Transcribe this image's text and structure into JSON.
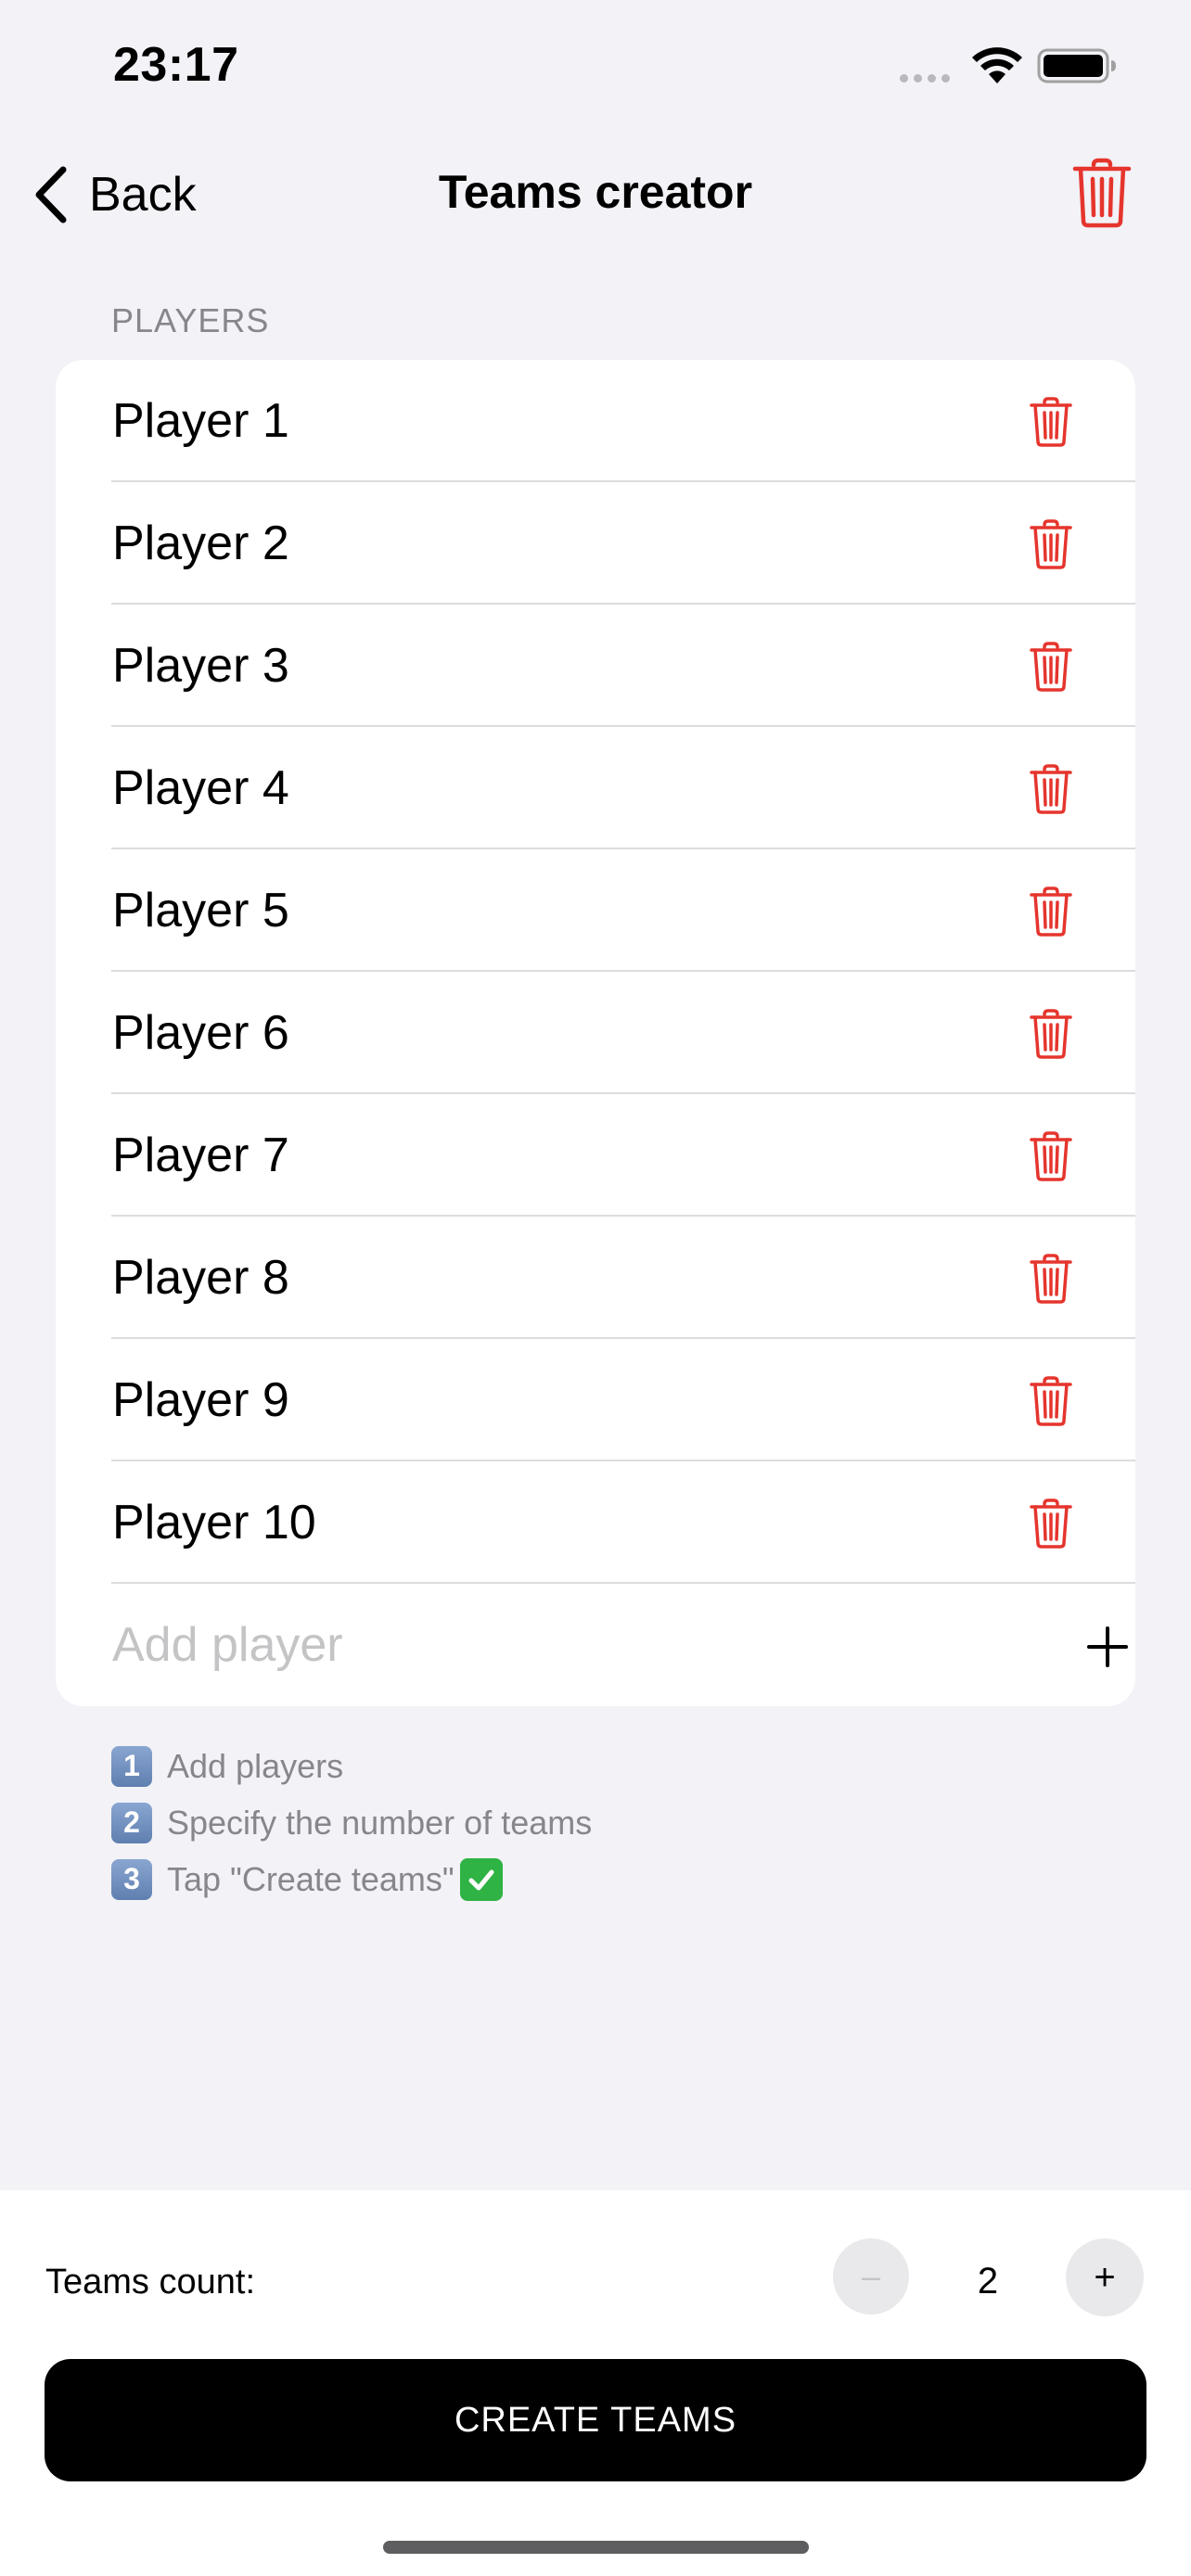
{
  "status_bar": {
    "time": "23:17",
    "icons": [
      "signal-dots-icon",
      "wifi-icon",
      "battery-icon"
    ]
  },
  "nav": {
    "back_label": "Back",
    "title": "Teams creator",
    "trash_icon": "trash-icon"
  },
  "section_header": "PLAYERS",
  "players": [
    {
      "name": "Player 1"
    },
    {
      "name": "Player 2"
    },
    {
      "name": "Player 3"
    },
    {
      "name": "Player 4"
    },
    {
      "name": "Player 5"
    },
    {
      "name": "Player 6"
    },
    {
      "name": "Player 7"
    },
    {
      "name": "Player 8"
    },
    {
      "name": "Player 9"
    },
    {
      "name": "Player 10"
    }
  ],
  "add_player": {
    "placeholder": "Add player",
    "value": ""
  },
  "instructions": [
    {
      "number": "1",
      "text": "Add players"
    },
    {
      "number": "2",
      "text": "Specify the number of teams"
    },
    {
      "number": "3",
      "text": "Tap \"Create teams\""
    }
  ],
  "teams_count": {
    "label": "Teams count:",
    "value": "2",
    "minus_label": "–",
    "plus_label": "+"
  },
  "create_button_label": "CREATE TEAMS",
  "colors": {
    "background": "#F2F2F7",
    "accent_red": "#E5352D",
    "button_black": "#000000",
    "secondary_text": "#86868B"
  }
}
